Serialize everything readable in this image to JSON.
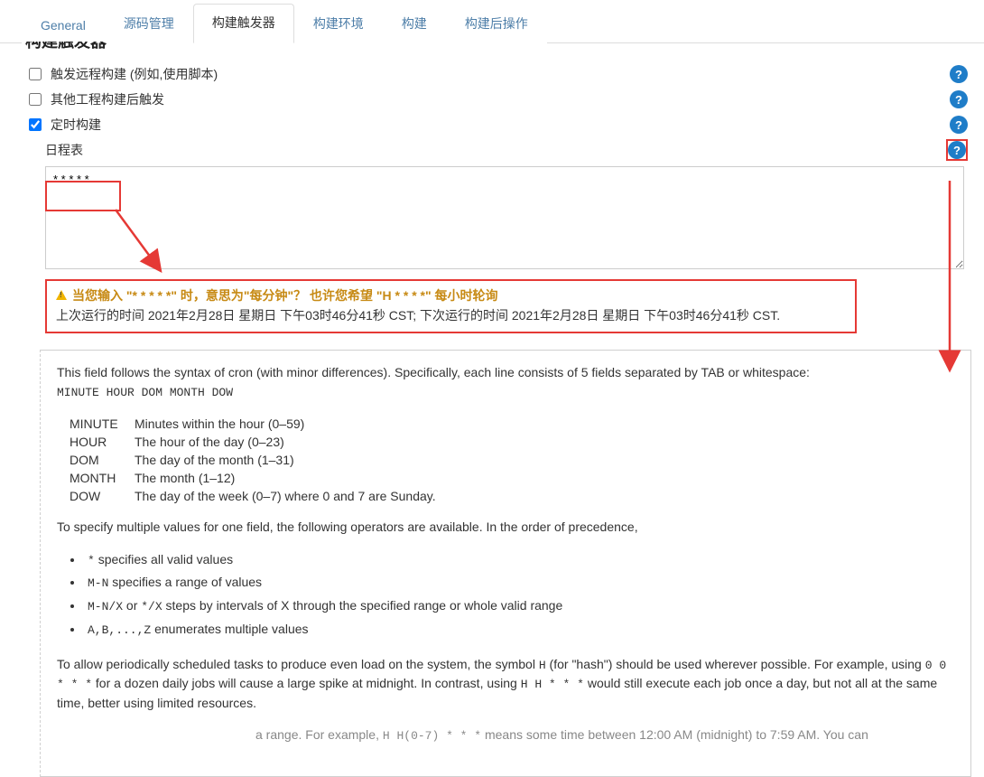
{
  "tabs": {
    "general": "General",
    "scm": "源码管理",
    "triggers": "构建触发器",
    "env": "构建环境",
    "build": "构建",
    "post": "构建后操作"
  },
  "section_title_cut": "构建触发器",
  "triggers": {
    "remote": {
      "label": "触发远程构建 (例如,使用脚本)",
      "checked": false
    },
    "after_other": {
      "label": "其他工程构建后触发",
      "checked": false
    },
    "timer": {
      "label": "定时构建",
      "checked": true
    }
  },
  "schedule": {
    "label": "日程表",
    "cron_value": "* * * * *"
  },
  "warning": {
    "line1": "当您输入 \"* * * * *\" 时，意思为\"每分钟\"？ 也许您希望 \"H * * * *\" 每小时轮询",
    "line2": "上次运行的时间 2021年2月28日 星期日 下午03时46分41秒 CST; 下次运行的时间 2021年2月28日 星期日 下午03时46分41秒 CST."
  },
  "help": {
    "intro_prefix": "This field follows the syntax of cron (with minor differences). Specifically, each line consists of 5 fields separated by TAB or whitespace:",
    "format_line": "MINUTE HOUR DOM MONTH DOW",
    "fields": [
      {
        "k": "MINUTE",
        "v": "Minutes within the hour (0–59)"
      },
      {
        "k": "HOUR",
        "v": "The hour of the day (0–23)"
      },
      {
        "k": "DOM",
        "v": "The day of the month (1–31)"
      },
      {
        "k": "MONTH",
        "v": "The month (1–12)"
      },
      {
        "k": "DOW",
        "v": "The day of the week (0–7) where 0 and 7 are Sunday."
      }
    ],
    "multi_intro": "To specify multiple values for one field, the following operators are available. In the order of precedence,",
    "ops": {
      "star": " specifies all valid values",
      "range": " specifies a range of values",
      "range_code": "M-N",
      "step_a": "M-N/X",
      "step_mid": " or ",
      "step_b": "*/X",
      "step_rest": " steps by intervals of X through the specified range or whole valid range",
      "enum_code": "A,B,...,Z",
      "enum_rest": " enumerates multiple values"
    },
    "hash_p1_a": "To allow periodically scheduled tasks to produce even load on the system, the symbol ",
    "hash_p1_b": " (for \"hash\") should be used wherever possible. For example, using ",
    "hash_p1_c": " for a dozen daily jobs will cause a large spike at midnight. In contrast, using ",
    "hash_p1_d": " would still execute each job once a day, but not all at the same time, better using limited resources.",
    "hash_code1": "H",
    "hash_code2": "0 0 * * *",
    "hash_code3": "H H * * *",
    "tail_a": "a range. For example, ",
    "tail_code": "H H(0-7) * * *",
    "tail_b": " means some time between 12:00 AM (midnight) to 7:59 AM. You can"
  }
}
